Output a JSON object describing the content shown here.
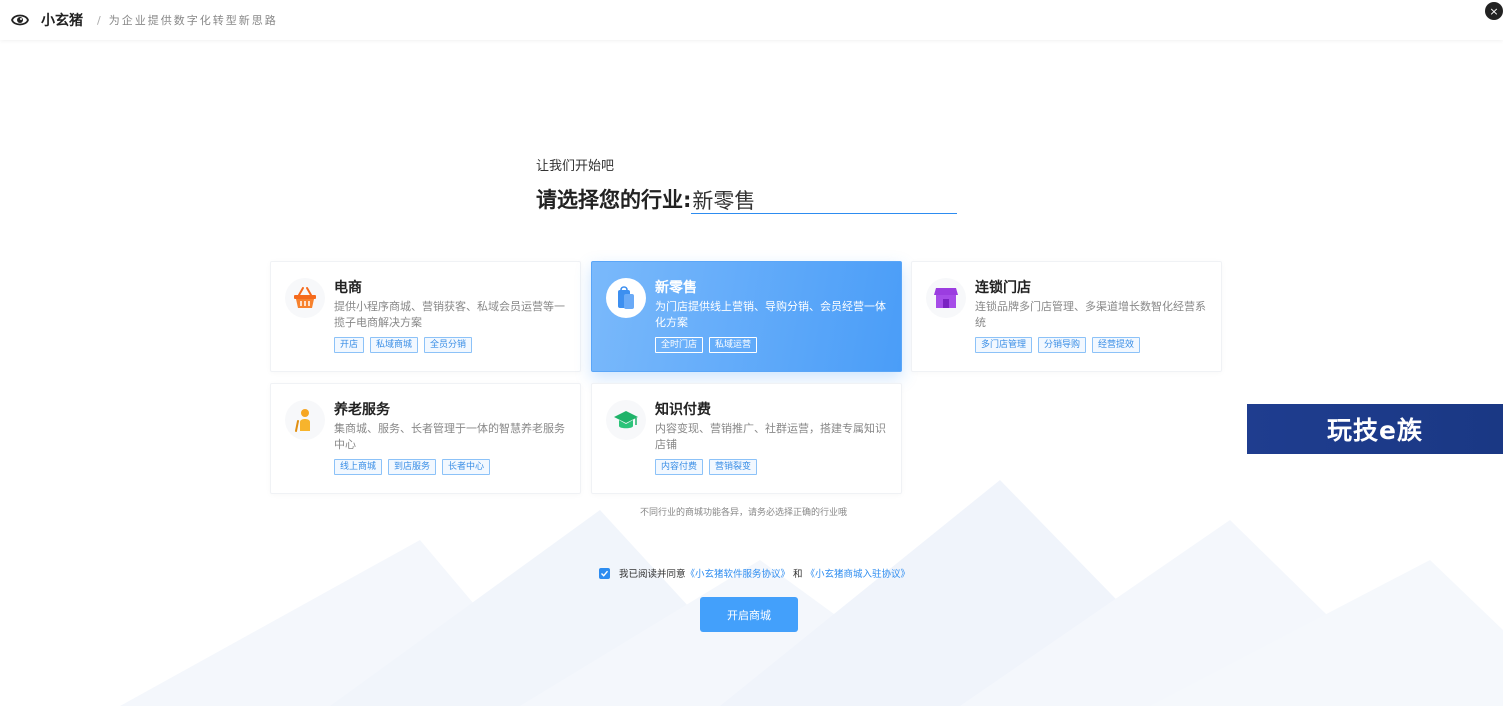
{
  "header": {
    "brand": "小玄猪",
    "separator": "/",
    "slogan": "为企业提供数字化转型新思路",
    "close_symbol": "×"
  },
  "intro": "让我们开始吧",
  "question": {
    "label": "请选择您的行业:",
    "value": "新零售"
  },
  "cards": [
    {
      "icon": "basket-icon",
      "title": "电商",
      "desc": "提供小程序商城、营销获客、私域会员运营等一揽子电商解决方案",
      "tags": [
        "开店",
        "私域商城",
        "全员分销"
      ],
      "selected": false
    },
    {
      "icon": "shopping-bag-icon",
      "title": "新零售",
      "desc": "为门店提供线上营销、导购分销、会员经营一体化方案",
      "tags": [
        "全时门店",
        "私域运营"
      ],
      "selected": true
    },
    {
      "icon": "storefront-icon",
      "title": "连锁门店",
      "desc": "连锁品牌多门店管理、多渠道增长数智化经营系统",
      "tags": [
        "多门店管理",
        "分销导购",
        "经营提效"
      ],
      "selected": false
    },
    {
      "icon": "elderly-person-icon",
      "title": "养老服务",
      "desc": "集商城、服务、长者管理于一体的智慧养老服务中心",
      "tags": [
        "线上商城",
        "到店服务",
        "长者中心"
      ],
      "selected": false
    },
    {
      "icon": "graduation-cap-icon",
      "title": "知识付费",
      "desc": "内容变现、营销推广、社群运营，搭建专属知识店铺",
      "tags": [
        "内容付费",
        "营销裂变"
      ],
      "selected": false
    }
  ],
  "hint": "不同行业的商城功能各异，请务必选择正确的行业哦",
  "agreement": {
    "checked": true,
    "prefix": "我已阅读并同意",
    "link1": "《小玄猪软件服务协议》",
    "conjunction": "和",
    "link2": "《小玄猪商城入驻协议》"
  },
  "start_button": "开启商城",
  "watermark": "玩技e族",
  "colors": {
    "accent": "#2d8cf0",
    "selected_card": "#4a9df8",
    "button": "#43a0fb",
    "watermark_bg": "#1f3d8f"
  }
}
